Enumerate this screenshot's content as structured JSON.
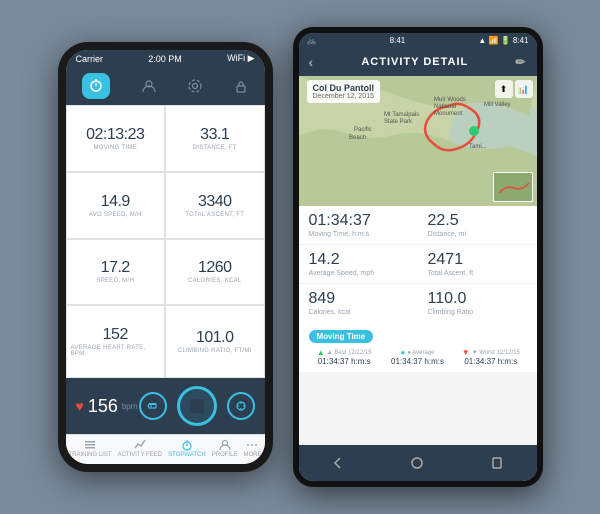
{
  "iphone": {
    "status_bar": {
      "carrier": "Carrier",
      "time": "2:00 PM",
      "wifi": "WiFi"
    },
    "tabs": [
      {
        "id": "stopwatch",
        "label": "",
        "active": true
      },
      {
        "id": "profile",
        "label": ""
      },
      {
        "id": "settings",
        "label": ""
      },
      {
        "id": "lock",
        "label": ""
      }
    ],
    "metrics": [
      {
        "value": "02:13:23",
        "label": "MOVING TIME"
      },
      {
        "value": "33.1",
        "label": "DISTANCE, ft"
      },
      {
        "value": "14.9",
        "label": "AVG SPEED, m/h"
      },
      {
        "value": "3340",
        "label": "TOTAL ASCENT, ft"
      },
      {
        "value": "17.2",
        "label": "SPEED, m/h"
      },
      {
        "value": "1260",
        "label": "CALORIES, kcal"
      },
      {
        "value": "152",
        "label": "AVERAGE HEART RATE, bpm"
      },
      {
        "value": "101.0",
        "label": "CLIMBING RATIO, ft/mi"
      }
    ],
    "bpm": "156",
    "bpm_label": "bpm",
    "bottom_nav": [
      {
        "label": "TRAINING LIST",
        "active": false
      },
      {
        "label": "ACTIVITY FEED",
        "active": false
      },
      {
        "label": "STOPWATCH",
        "active": true
      },
      {
        "label": "PROFILE",
        "active": false
      },
      {
        "label": "MORE",
        "active": false
      }
    ]
  },
  "android": {
    "status_bar": {
      "left_icons": "🚲",
      "time": "8:41",
      "right_icons": "📶🔋"
    },
    "header": {
      "title": "ACTIVITY DETAIL",
      "back": "<",
      "edit": "✏"
    },
    "map": {
      "title": "Col Du Pantoll",
      "date": "December 12, 2015"
    },
    "stats": [
      {
        "value": "01:34:37",
        "label": "Moving Time, h:m:s"
      },
      {
        "value": "22.5",
        "label": "Distance, mi"
      },
      {
        "value": "14.2",
        "label": "Average Speed, mph"
      },
      {
        "value": "2471",
        "label": "Total Ascent, ft"
      },
      {
        "value": "849",
        "label": "Calories, kcal"
      },
      {
        "value": "110.0",
        "label": "Climbing Ratio"
      }
    ],
    "moving_time": {
      "badge": "Moving Time",
      "best_label": "▲ Best 12/12/15",
      "best_value": "01:34:37 h:m:s",
      "avg_label": "● Average",
      "avg_value": "01:34:37 h:m:s",
      "worst_label": "▼ Worst 12/12/15",
      "worst_value": "01:34:37 h:m:s"
    }
  }
}
